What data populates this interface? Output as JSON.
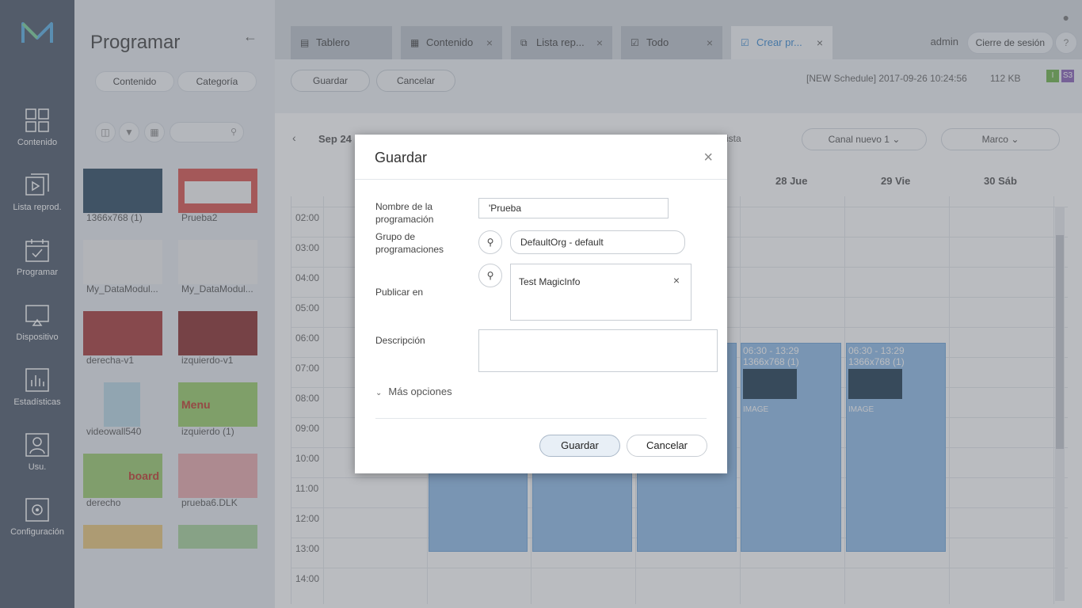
{
  "nav": {
    "items": [
      {
        "label": "Contenido",
        "icon": "grid-icon"
      },
      {
        "label": "Lista reprod.",
        "icon": "playlist-icon"
      },
      {
        "label": "Programar",
        "icon": "calendar-check-icon"
      },
      {
        "label": "Dispositivo",
        "icon": "monitor-icon"
      },
      {
        "label": "Estadísticas",
        "icon": "bar-chart-icon"
      },
      {
        "label": "Usu.",
        "icon": "user-icon"
      },
      {
        "label": "Configuración",
        "icon": "gear-icon"
      }
    ]
  },
  "panel": {
    "title": "Programar",
    "filter_buttons": [
      "Contenido",
      "Categoría"
    ],
    "thumbnails": [
      {
        "label": "1366x768 (1)",
        "color": "#2d4b63"
      },
      {
        "label": "Prueba2",
        "color": "#d9534f"
      },
      {
        "label": "My_DataModul...",
        "color": "#f2f2f2"
      },
      {
        "label": "My_DataModul...",
        "color": "#f2f2f2"
      },
      {
        "label": "derecha-v1",
        "color": "#a83a3a"
      },
      {
        "label": "izquierdo-v1",
        "color": "#8b2d2d"
      },
      {
        "label": "videowall540",
        "color": "#b8d7e6"
      },
      {
        "label": "izquierdo (1)",
        "color": "#9acd6a"
      },
      {
        "label": "derecho",
        "color": "#9ccb6e"
      },
      {
        "label": "prueba6.DLK",
        "color": "#e8a9ad"
      }
    ],
    "thumb_text": {
      "menu": "Menu",
      "board": "board"
    }
  },
  "tabs": [
    {
      "label": "Tablero",
      "icon": "dashboard-icon",
      "closable": false
    },
    {
      "label": "Contenido",
      "icon": "grid-icon",
      "closable": true
    },
    {
      "label": "Lista rep...",
      "icon": "playlist-icon",
      "closable": true
    },
    {
      "label": "Todo",
      "icon": "calendar-icon",
      "closable": true
    },
    {
      "label": "Crear pr...",
      "icon": "calendar-check-icon",
      "closable": true
    }
  ],
  "header": {
    "user": "admin",
    "logout": "Cierre de sesión",
    "help": "?"
  },
  "toolbar": {
    "save": "Guardar",
    "cancel": "Cancelar",
    "schedule_name": "[NEW Schedule] 2017-09-26 10:24:56",
    "size": "112 KB",
    "badges": [
      {
        "text": "I",
        "color": "#6fb34a"
      },
      {
        "text": "S3",
        "color": "#8a63b8"
      }
    ]
  },
  "calendar": {
    "range_label": "Sep 24",
    "view_label": "ista",
    "channel": "Canal nuevo 1",
    "frame": "Marco",
    "days": [
      "28 Jue",
      "29 Vie",
      "30 Sáb"
    ],
    "hours": [
      "02:00",
      "03:00",
      "04:00",
      "05:00",
      "06:00",
      "07:00",
      "08:00",
      "09:00",
      "10:00",
      "11:00",
      "12:00",
      "13:00",
      "14:00"
    ],
    "event": {
      "time": "06:30 - 13:29",
      "name": "1366x768 (1)",
      "type": "IMAGE"
    }
  },
  "dialog": {
    "title": "Guardar",
    "fields": {
      "name_label": "Nombre de la programación",
      "name_value": "'Prueba",
      "group_label": "Grupo de programaciones",
      "group_value": "DefaultOrg - default",
      "publish_label": "Publicar en",
      "publish_item": "Test MagicInfo",
      "description_label": "Descripción"
    },
    "more_options": "Más opciones",
    "save": "Guardar",
    "cancel": "Cancelar"
  }
}
